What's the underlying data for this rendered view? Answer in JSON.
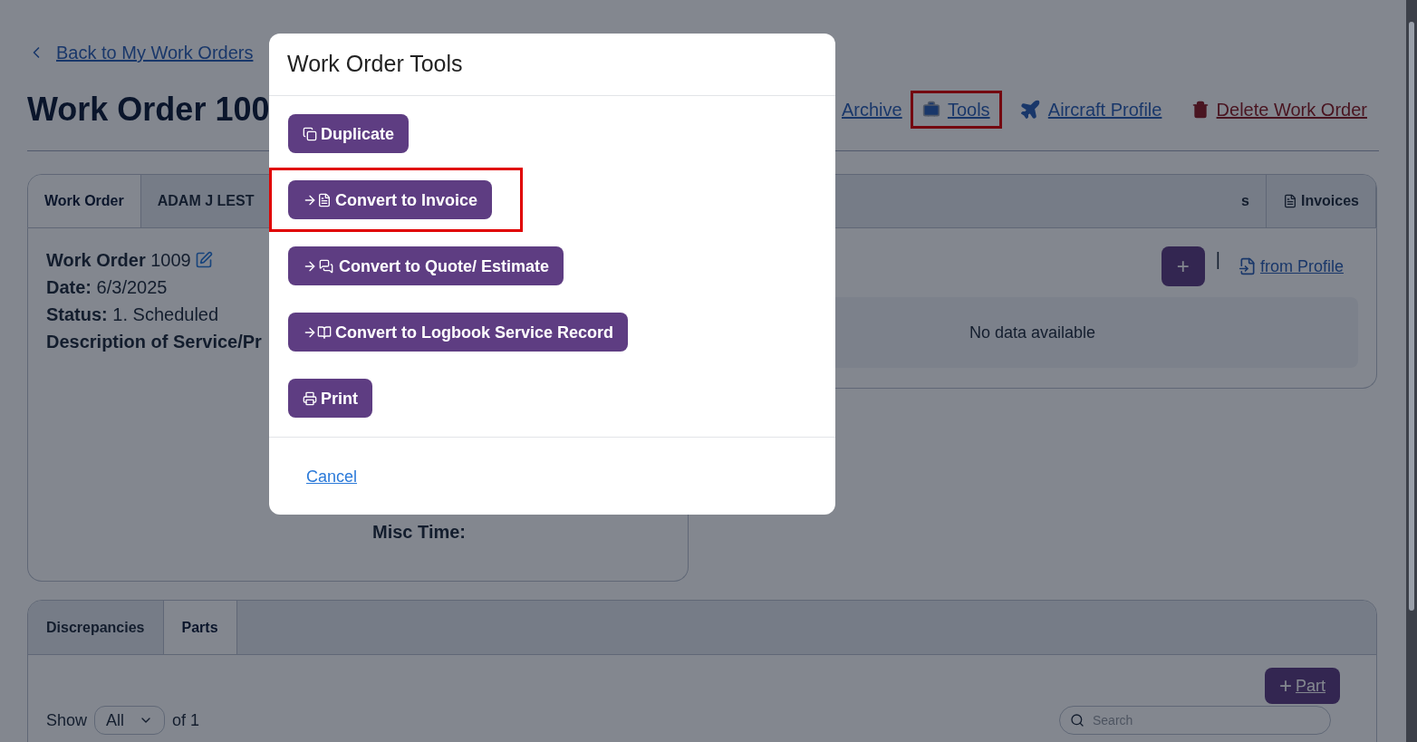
{
  "back_link": "Back to My Work Orders",
  "title": "Work Order 100",
  "actions": [
    {
      "label": "Archive",
      "kind": "plain",
      "highlighted": false
    },
    {
      "label": "Tools",
      "kind": "toolbox",
      "highlighted": true
    },
    {
      "label": "Aircraft Profile",
      "kind": "plane",
      "highlighted": false
    },
    {
      "label": "Delete Work Order",
      "kind": "trash",
      "highlighted": false
    }
  ],
  "top_tabs": [
    {
      "label": "Work Order",
      "selected": true,
      "kind": "plain"
    },
    {
      "label": "ADAM J LEST",
      "selected": false,
      "kind": "plain"
    },
    {
      "label": "s",
      "selected": false,
      "kind": "plain"
    },
    {
      "label": "Invoices",
      "selected": false,
      "kind": "invoice"
    }
  ],
  "details": [
    {
      "label": "Work Order",
      "value": "1009",
      "editable": true
    },
    {
      "label": "Date:",
      "value": "6/3/2025",
      "editable": false
    },
    {
      "label": "Status:",
      "value": "1. Scheduled",
      "editable": false
    },
    {
      "label": "Description of Service/Pr",
      "editable": false
    }
  ],
  "misc_time": "Misc Time:",
  "add_symbol": "+",
  "separator": "|",
  "from_profile": "from Profile",
  "empty_text": "No data available",
  "bottom_tabs": [
    {
      "label": "Discrepancies",
      "selected": false
    },
    {
      "label": "Parts",
      "selected": true
    }
  ],
  "add_part": {
    "symbol": "+",
    "label": "Part"
  },
  "show_label": "Show",
  "show_value": "All",
  "of_text": "of 1",
  "search": {
    "placeholder": "Search"
  },
  "modal": {
    "title": "Work Order Tools",
    "buttons": [
      {
        "label": "Duplicate",
        "kind": "copy",
        "highlighted": false
      },
      {
        "label": "Convert to Invoice",
        "kind": "invoice",
        "highlighted": true
      },
      {
        "label": "Convert to Quote/ Estimate",
        "kind": "quote",
        "highlighted": false
      },
      {
        "label": "Convert to Logbook Service Record",
        "kind": "logbook",
        "highlighted": false
      },
      {
        "label": "Print",
        "kind": "print",
        "highlighted": false
      }
    ],
    "cancel": "Cancel"
  }
}
